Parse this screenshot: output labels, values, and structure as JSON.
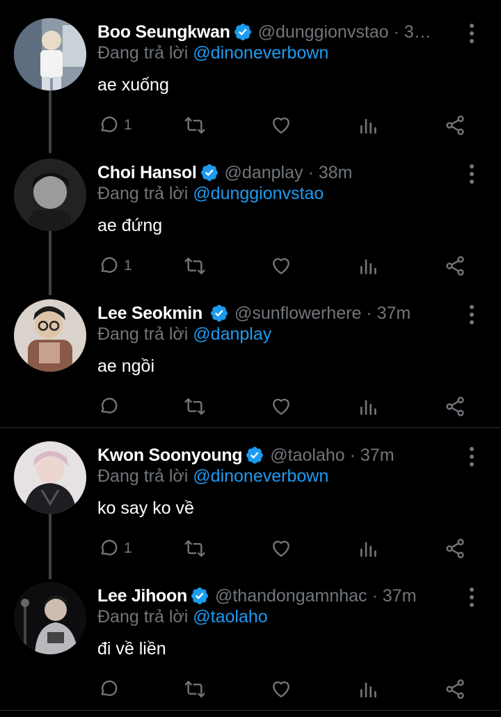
{
  "colors": {
    "background": "#000000",
    "text": "#ffffff",
    "muted": "#71767b",
    "accent": "#1d9bf0",
    "line": "#3d4247"
  },
  "tweets": [
    {
      "name": "Boo Seungkwan",
      "verified": true,
      "handle": "@dunggionvstao · 3…",
      "replying_prefix": "Đang trả lời ",
      "replying_to": "@dinoneverbown",
      "text": "ae xuống",
      "reply_count": "1",
      "retweet_count": "",
      "like_count": ""
    },
    {
      "name": "Choi Hansol",
      "verified": true,
      "handle": "@danplay · 38m",
      "replying_prefix": "Đang trả lời ",
      "replying_to": "@dunggionvstao",
      "text": "ae đứng",
      "reply_count": "1",
      "retweet_count": "",
      "like_count": ""
    },
    {
      "name": "Lee Seokmin",
      "verified": true,
      "handle": "@sunflowerhere · 37m",
      "replying_prefix": "Đang trả lời ",
      "replying_to": "@danplay",
      "text": "ae ngồi",
      "reply_count": "",
      "retweet_count": "",
      "like_count": ""
    },
    {
      "name": "Kwon Soonyoung",
      "verified": true,
      "handle": "@taolaho · 37m",
      "replying_prefix": "Đang trả lời ",
      "replying_to": "@dinoneverbown",
      "text": "ko say ko về",
      "reply_count": "1",
      "retweet_count": "",
      "like_count": ""
    },
    {
      "name": "Lee Jihoon",
      "verified": true,
      "handle": "@thandongamnhac · 37m",
      "replying_prefix": "Đang trả lời ",
      "replying_to": "@taolaho",
      "text": "đi về liền",
      "reply_count": "",
      "retweet_count": "",
      "like_count": ""
    }
  ],
  "icons": {
    "reply": "reply-icon",
    "retweet": "retweet-icon",
    "like": "heart-icon",
    "views": "views-icon",
    "share": "share-icon",
    "more": "more-icon",
    "verified": "verified-badge-icon"
  }
}
